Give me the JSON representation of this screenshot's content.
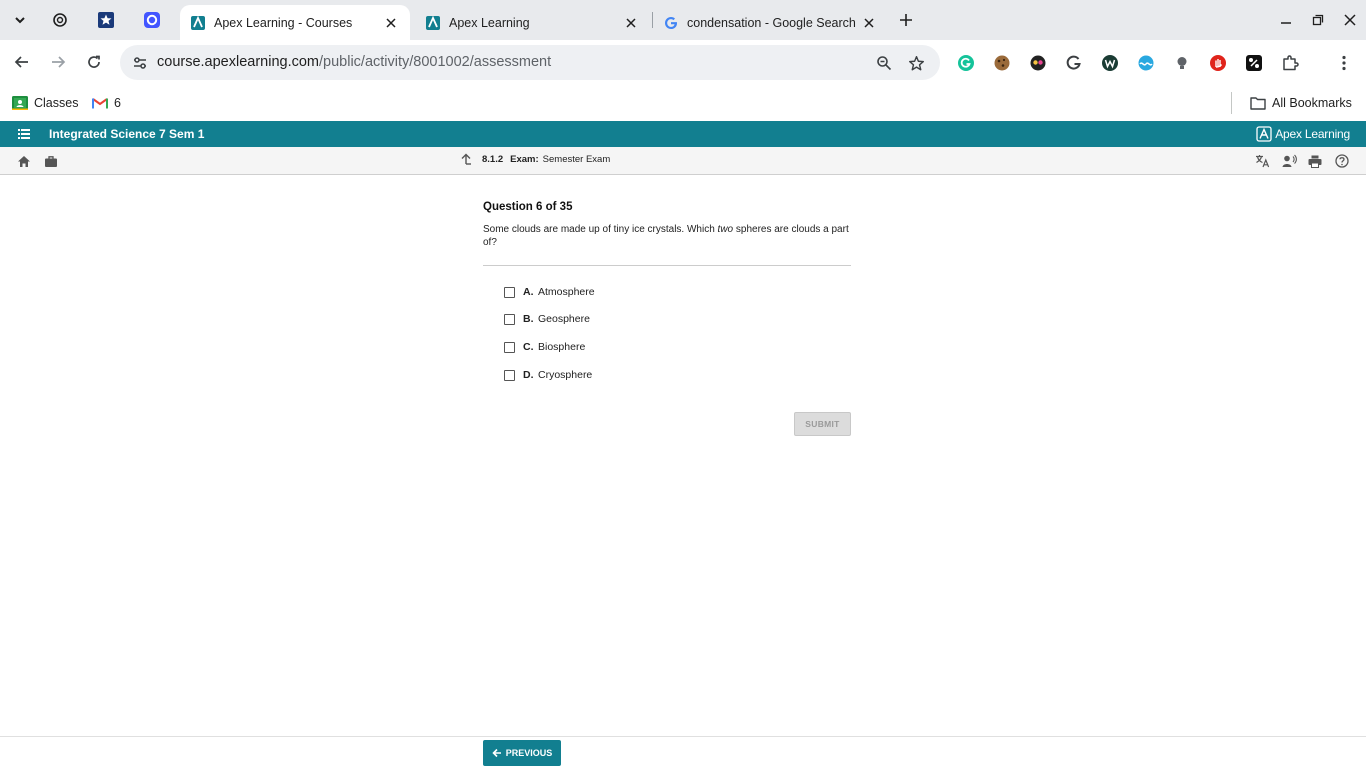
{
  "browser": {
    "tabs": [
      {
        "title": "Apex Learning - Courses",
        "active": true
      },
      {
        "title": "Apex Learning",
        "active": false
      },
      {
        "title": "condensation - Google Search",
        "active": false
      }
    ],
    "url": {
      "host": "course.apexlearning.com",
      "path": "/public/activity/8001002/assessment"
    },
    "bookmarks": [
      {
        "label": "Classes",
        "icon": "google-classroom-icon"
      },
      {
        "label": "6",
        "icon": "gmail-icon"
      }
    ],
    "all_bookmarks_label": "All Bookmarks"
  },
  "app": {
    "course_title": "Integrated Science 7 Sem 1",
    "brand": "Apex Learning",
    "breadcrumb": {
      "number": "8.1.2",
      "kind": "Exam:",
      "name": "Semester Exam"
    }
  },
  "question": {
    "header": "Question 6 of 35",
    "text_before": "Some clouds are made up of tiny ice crystals. Which ",
    "text_emphasis": "two",
    "text_after": " spheres are clouds a part of?",
    "options": [
      {
        "letter": "A.",
        "label": "Atmosphere"
      },
      {
        "letter": "B.",
        "label": "Geosphere"
      },
      {
        "letter": "C.",
        "label": "Biosphere"
      },
      {
        "letter": "D.",
        "label": "Cryosphere"
      }
    ],
    "submit_label": "SUBMIT"
  },
  "footer": {
    "previous_label": "PREVIOUS"
  },
  "colors": {
    "accent": "#127f90",
    "tabstrip": "#e8eaed"
  }
}
